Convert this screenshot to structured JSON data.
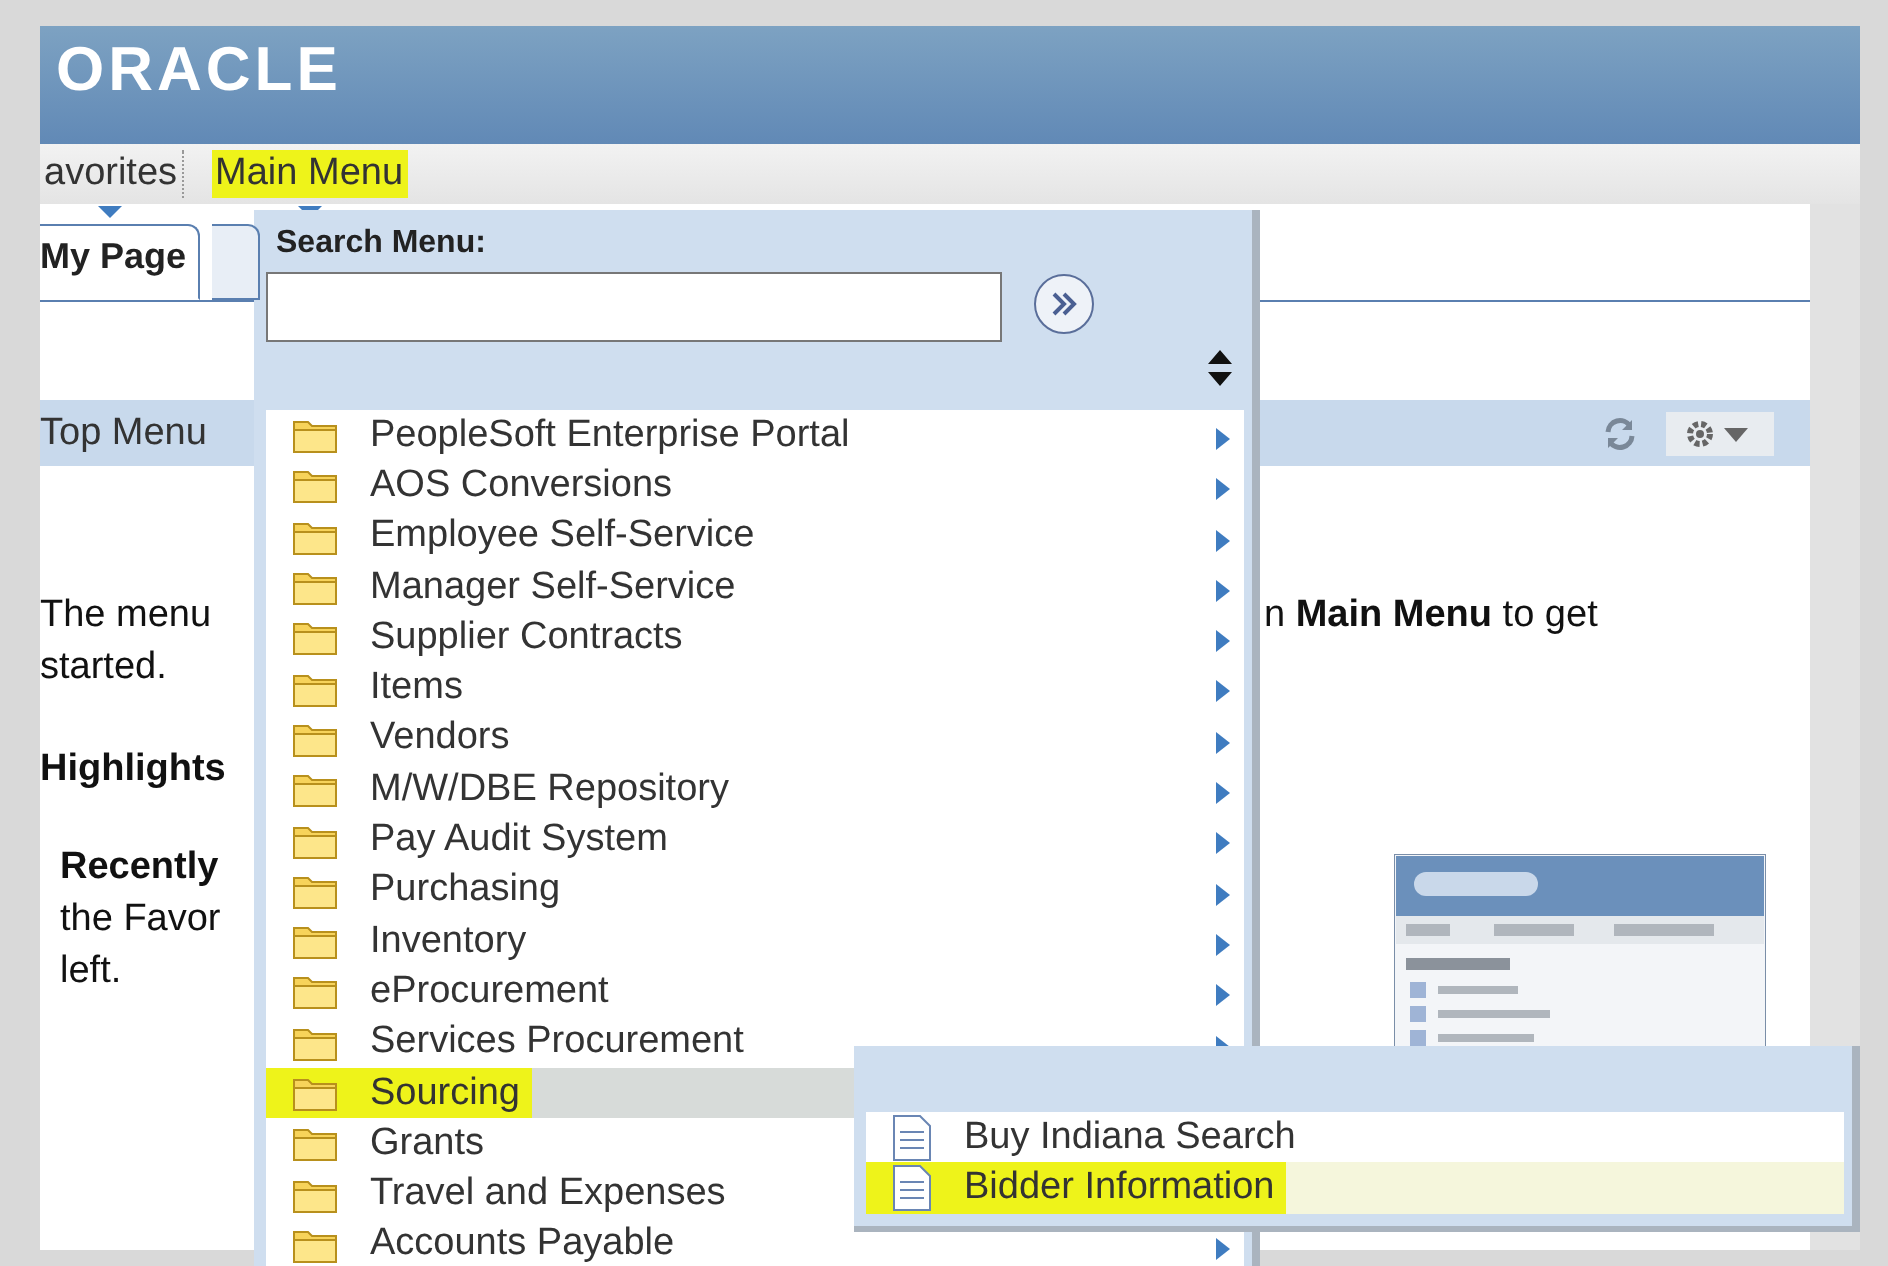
{
  "header": {
    "logo": "ORACLE"
  },
  "nav": [
    {
      "label": "avorites",
      "highlighted": false
    },
    {
      "label": "Main Menu",
      "highlighted": true
    }
  ],
  "tabs": [
    {
      "label": "My Page",
      "selected": true
    },
    {
      "selected": false
    }
  ],
  "panel": {
    "title": "Top Menu",
    "lines": [
      {
        "kind": "split",
        "left": "The menu",
        "right": "n **Main Menu** to get"
      },
      {
        "kind": "plain",
        "text": "started."
      },
      {
        "kind": "heading",
        "text": "Highlights"
      },
      {
        "kind": "subheading",
        "text": "Recently"
      },
      {
        "kind": "indented",
        "text": "the Favor"
      },
      {
        "kind": "indented",
        "text": "left."
      }
    ]
  },
  "main_menu": {
    "search_label": "Search Menu:",
    "items": [
      {
        "label": "PeopleSoft Enterprise Portal",
        "selected": false,
        "highlighted": false,
        "arrow": true
      },
      {
        "label": "AOS Conversions",
        "selected": false,
        "highlighted": false,
        "arrow": true
      },
      {
        "label": "Employee Self-Service",
        "selected": false,
        "highlighted": false,
        "arrow": true
      },
      {
        "label": "Manager Self-Service",
        "selected": false,
        "highlighted": false,
        "arrow": true
      },
      {
        "label": "Supplier Contracts",
        "selected": false,
        "highlighted": false,
        "arrow": true
      },
      {
        "label": "Items",
        "selected": false,
        "highlighted": false,
        "arrow": true
      },
      {
        "label": "Vendors",
        "selected": false,
        "highlighted": false,
        "arrow": true
      },
      {
        "label": "M/W/DBE Repository",
        "selected": false,
        "highlighted": false,
        "arrow": true
      },
      {
        "label": "Pay Audit System",
        "selected": false,
        "highlighted": false,
        "arrow": true
      },
      {
        "label": "Purchasing",
        "selected": false,
        "highlighted": false,
        "arrow": true
      },
      {
        "label": "Inventory",
        "selected": false,
        "highlighted": false,
        "arrow": true
      },
      {
        "label": "eProcurement",
        "selected": false,
        "highlighted": false,
        "arrow": true
      },
      {
        "label": "Services Procurement",
        "selected": false,
        "highlighted": false,
        "arrow": true
      },
      {
        "label": "Sourcing",
        "selected": true,
        "highlighted": true,
        "arrow": false
      },
      {
        "label": "Grants",
        "selected": false,
        "highlighted": false
      },
      {
        "label": "Travel and Expenses",
        "selected": false,
        "highlighted": false
      },
      {
        "label": "Accounts Payable",
        "selected": false,
        "highlighted": false,
        "arrow": true
      }
    ]
  },
  "submenu": {
    "items": [
      {
        "label": "Buy Indiana Search",
        "selected": false,
        "highlighted": false
      },
      {
        "label": "Bidder Information",
        "selected": true,
        "highlighted": true
      }
    ]
  }
}
